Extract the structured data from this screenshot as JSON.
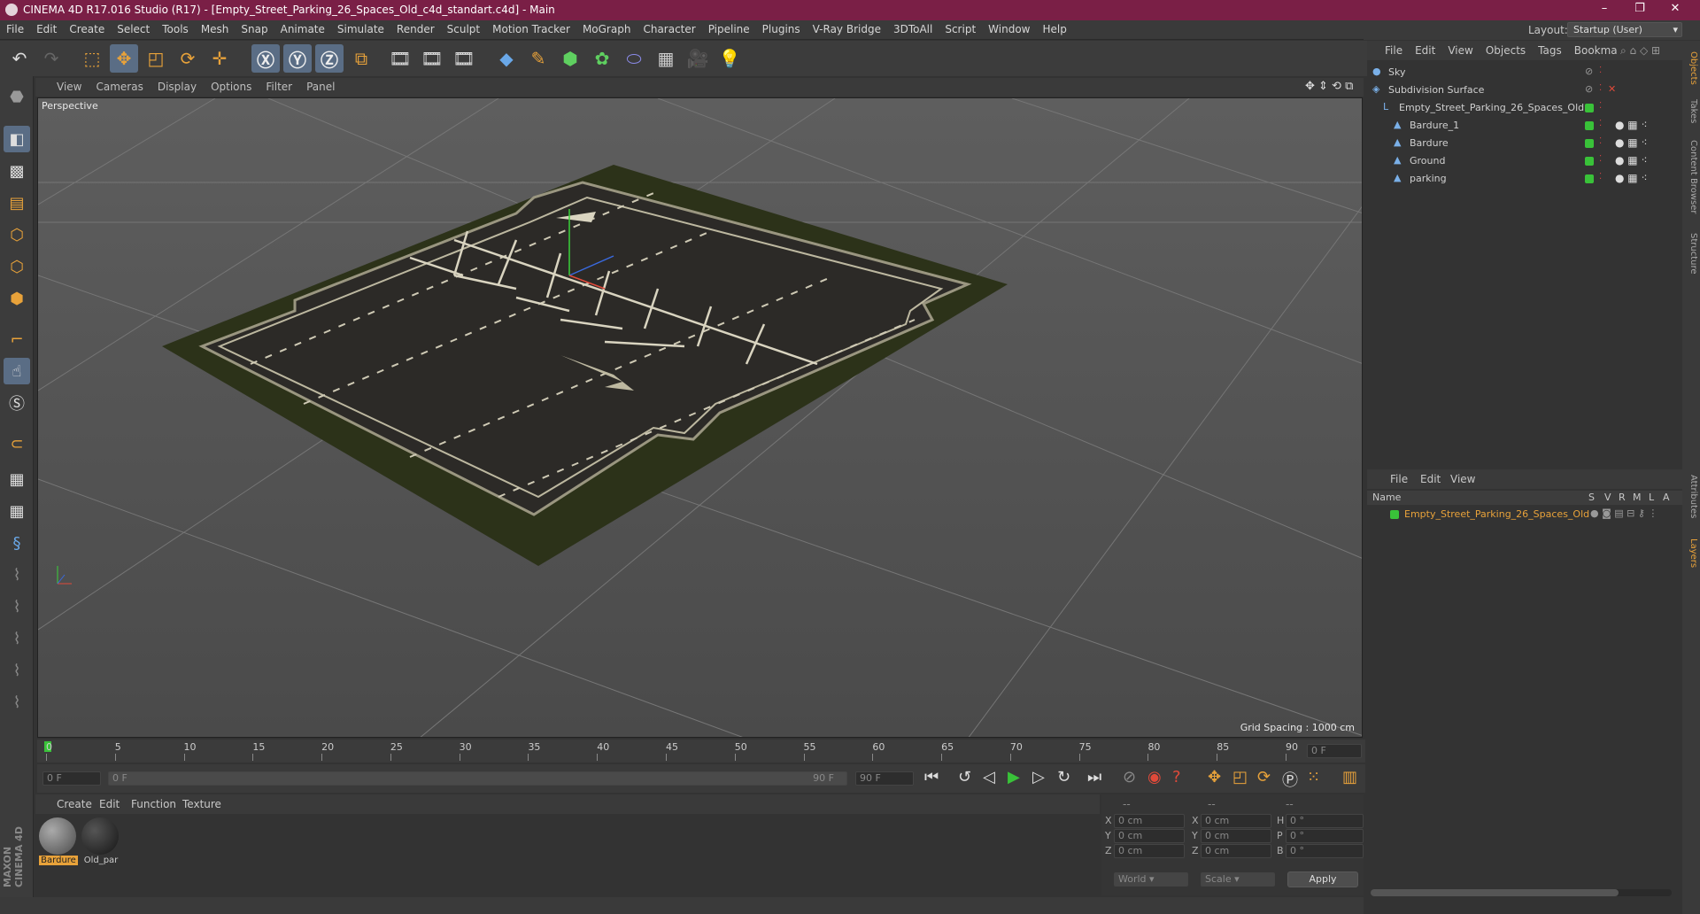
{
  "title": "CINEMA 4D R17.016 Studio (R17) - [Empty_Street_Parking_26_Spaces_Old_c4d_standart.c4d] - Main",
  "menu": [
    "File",
    "Edit",
    "Create",
    "Select",
    "Tools",
    "Mesh",
    "Snap",
    "Animate",
    "Simulate",
    "Render",
    "Sculpt",
    "Motion Tracker",
    "MoGraph",
    "Character",
    "Pipeline",
    "Plugins",
    "V-Ray Bridge",
    "3DToAll",
    "Script",
    "Window",
    "Help"
  ],
  "layout": {
    "label": "Layout:",
    "value": "Startup (User)"
  },
  "viewport_menu": [
    "View",
    "Cameras",
    "Display",
    "Options",
    "Filter",
    "Panel"
  ],
  "viewport": {
    "name": "Perspective",
    "grid_spacing": "Grid Spacing : 1000 cm"
  },
  "object_menu": [
    "File",
    "Edit",
    "View",
    "Objects",
    "Tags",
    "Bookma"
  ],
  "objects": [
    {
      "name": "Sky",
      "indent": 0
    },
    {
      "name": "Subdivision Surface",
      "indent": 0
    },
    {
      "name": "Empty_Street_Parking_26_Spaces_Old",
      "indent": 1
    },
    {
      "name": "Bardure_1",
      "indent": 2
    },
    {
      "name": "Bardure",
      "indent": 2
    },
    {
      "name": "Ground",
      "indent": 2
    },
    {
      "name": "parking",
      "indent": 2
    }
  ],
  "layer_menu": [
    "File",
    "Edit",
    "View"
  ],
  "layer_header": {
    "name": "Name",
    "cols": [
      "S",
      "V",
      "R",
      "M",
      "L",
      "A"
    ]
  },
  "layer_row": "Empty_Street_Parking_26_Spaces_Old",
  "timeline": {
    "ticks": [
      "0",
      "5",
      "10",
      "15",
      "20",
      "25",
      "30",
      "35",
      "40",
      "45",
      "50",
      "55",
      "60",
      "65",
      "70",
      "75",
      "80",
      "85",
      "90"
    ],
    "current": "0 F"
  },
  "transport": {
    "start": "0 F",
    "slider_start": "0 F",
    "slider_end": "90 F",
    "end": "90 F"
  },
  "material_menu": [
    "Create",
    "Edit",
    "Function",
    "Texture"
  ],
  "materials": [
    "Bardure",
    "Old_par"
  ],
  "coords": {
    "header": [
      "--",
      "--",
      "--"
    ],
    "rows": [
      {
        "a": "X",
        "av": "0 cm",
        "b": "X",
        "bv": "0 cm",
        "c": "H",
        "cv": "0 °"
      },
      {
        "a": "Y",
        "av": "0 cm",
        "b": "Y",
        "bv": "0 cm",
        "c": "P",
        "cv": "0 °"
      },
      {
        "a": "Z",
        "av": "0 cm",
        "b": "Z",
        "bv": "0 cm",
        "c": "B",
        "cv": "0 °"
      }
    ],
    "world": "World",
    "scale": "Scale",
    "apply": "Apply"
  },
  "side_tabs": [
    "Objects",
    "Takes",
    "Content Browser",
    "Structure",
    "Attributes",
    "Layers"
  ],
  "colors": {
    "accent": "#e8a23a",
    "titlebar": "#7a1f46",
    "layer_active": "#e8a23a",
    "green_tag": "#39c239"
  }
}
